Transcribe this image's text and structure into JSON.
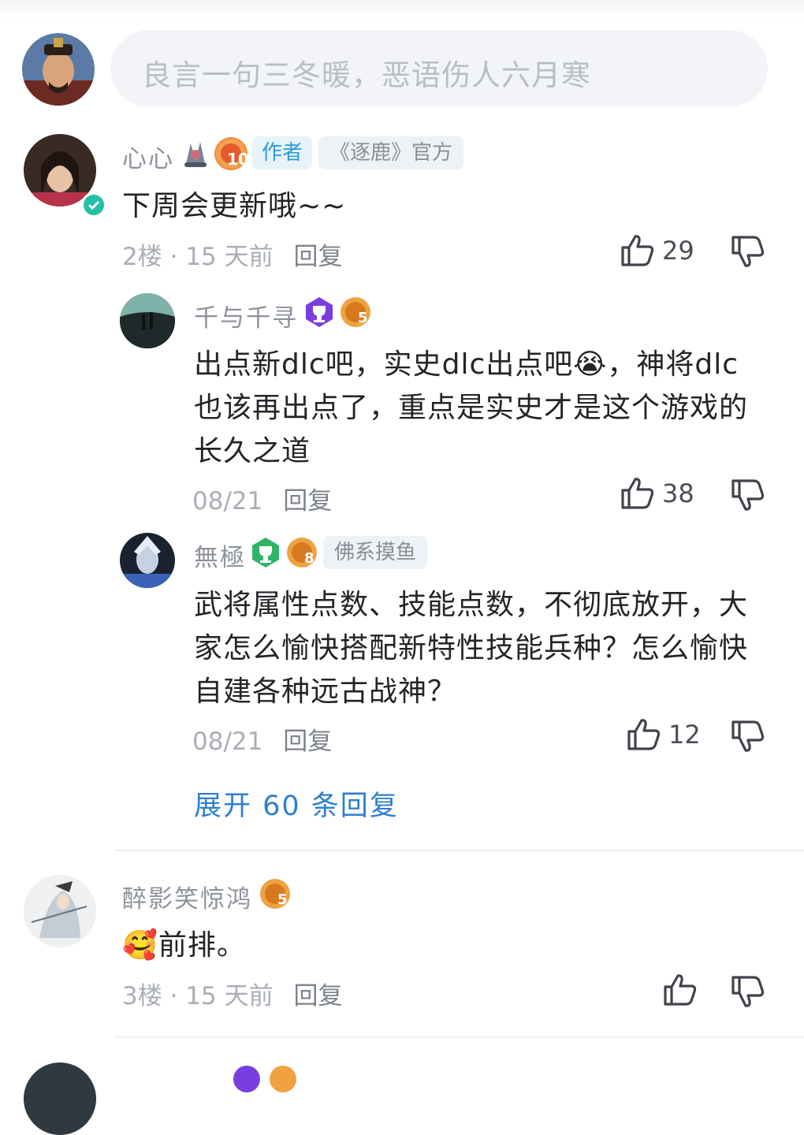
{
  "composer": {
    "placeholder": "良言一句三冬暖，恶语伤人六月寒"
  },
  "comments": [
    {
      "user": "心心",
      "tags": {
        "author": "作者",
        "official": "《逐鹿》官方",
        "level": "10"
      },
      "text": "下周会更新哦~~",
      "floor": "2楼",
      "time": "15 天前",
      "reply_label": "回复",
      "likes": "29",
      "replies": [
        {
          "user": "千与千寻",
          "level": "5",
          "text": "出点新dlc吧，实史dlc出点吧😭，神将dlc也该再出点了，重点是实史才是这个游戏的长久之道",
          "date": "08/21",
          "reply_label": "回复",
          "likes": "38"
        },
        {
          "user": "無極",
          "level": "8",
          "tag": "佛系摸鱼",
          "text": "武将属性点数、技能点数，不彻底放开，大家怎么愉快搭配新特性技能兵种？怎么愉快自建各种远古战神？",
          "date": "08/21",
          "reply_label": "回复",
          "likes": "12"
        }
      ],
      "expand_label": "展开 60 条回复"
    },
    {
      "user": "醉影笑惊鸿",
      "level": "5",
      "text": "🥰前排。",
      "floor": "3楼",
      "time": "15 天前",
      "reply_label": "回复",
      "likes": ""
    }
  ],
  "colors": {
    "accent": "#2d7fd0",
    "verified": "#23c0a3",
    "author_tag": "#2e9bd6"
  },
  "icons": [
    "thumbs-up-icon",
    "thumbs-down-icon",
    "verified-icon",
    "trophy-badge-icon",
    "level-badge-icon"
  ]
}
